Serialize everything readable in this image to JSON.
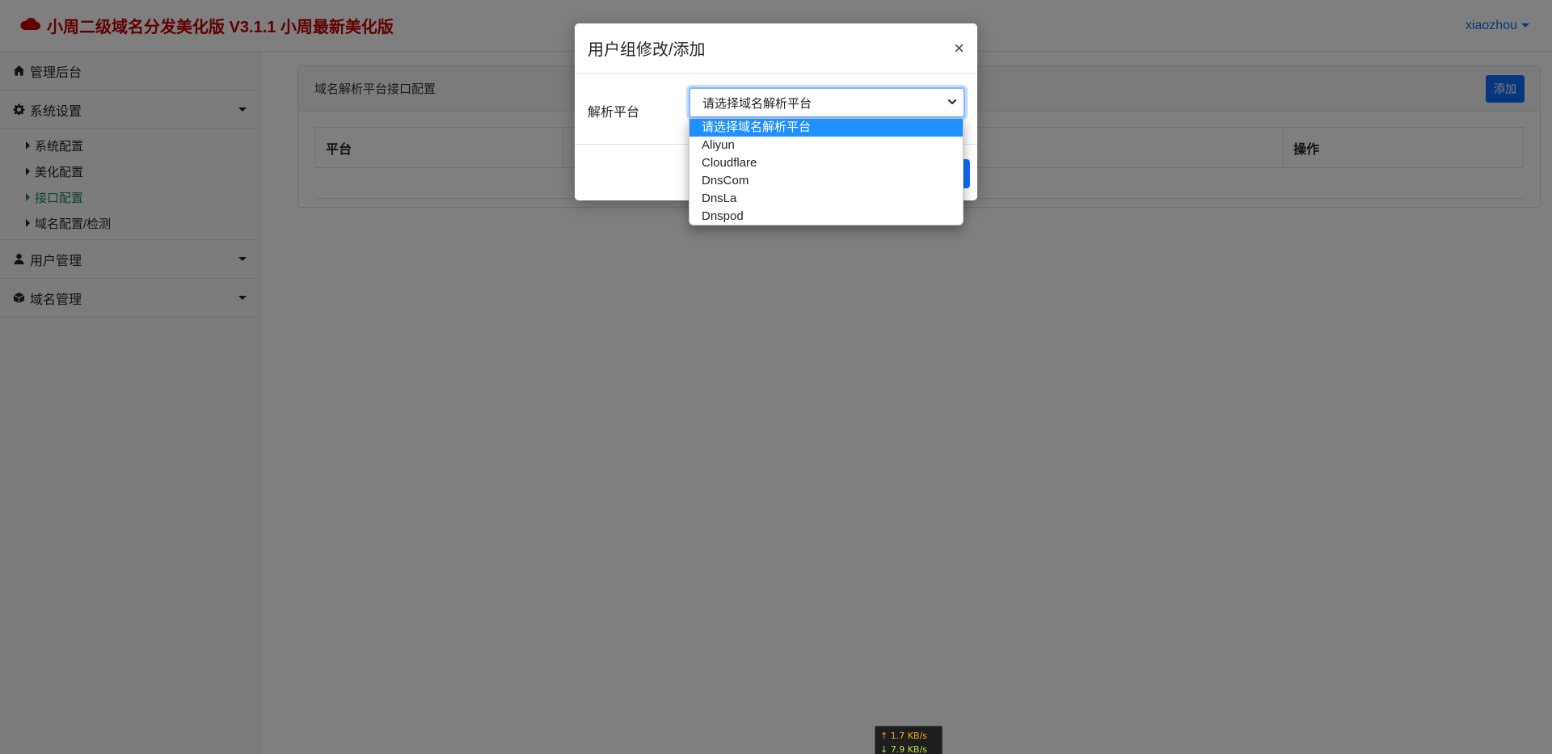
{
  "header": {
    "brand_title": "小周二级域名分发美化版 V3.1.1 小周最新美化版",
    "brand_icon": "cloud-icon",
    "brand_color": "#c00000",
    "user_name": "xiaozhou"
  },
  "sidebar": {
    "admin": "管理后台",
    "system_settings": "系统设置",
    "sub_items": [
      {
        "label": "系统配置",
        "active": false
      },
      {
        "label": "美化配置",
        "active": false
      },
      {
        "label": "接口配置",
        "active": true
      },
      {
        "label": "域名配置/检测",
        "active": false
      }
    ],
    "user_management": "用户管理",
    "domain_management": "域名管理"
  },
  "main": {
    "card_title": "域名解析平台接口配置",
    "add_button": "添加",
    "table_headers": [
      "平台",
      "",
      "操作"
    ]
  },
  "modal": {
    "title": "用户组修改/添加",
    "close": "×",
    "field_label": "解析平台",
    "select_value": "请选择域名解析平台",
    "options": [
      "请选择域名解析平台",
      "Aliyun",
      "Cloudflare",
      "DnsCom",
      "DnsLa",
      "Dnspod"
    ],
    "selected_index": 0
  },
  "speed_widget": {
    "upload": "↑ 1.7 KB/s",
    "download": "↓ 7.9 KB/s"
  },
  "colors": {
    "accent": "#0d6efd",
    "active_nav": "#198754",
    "option_highlight": "#1e90ff"
  }
}
